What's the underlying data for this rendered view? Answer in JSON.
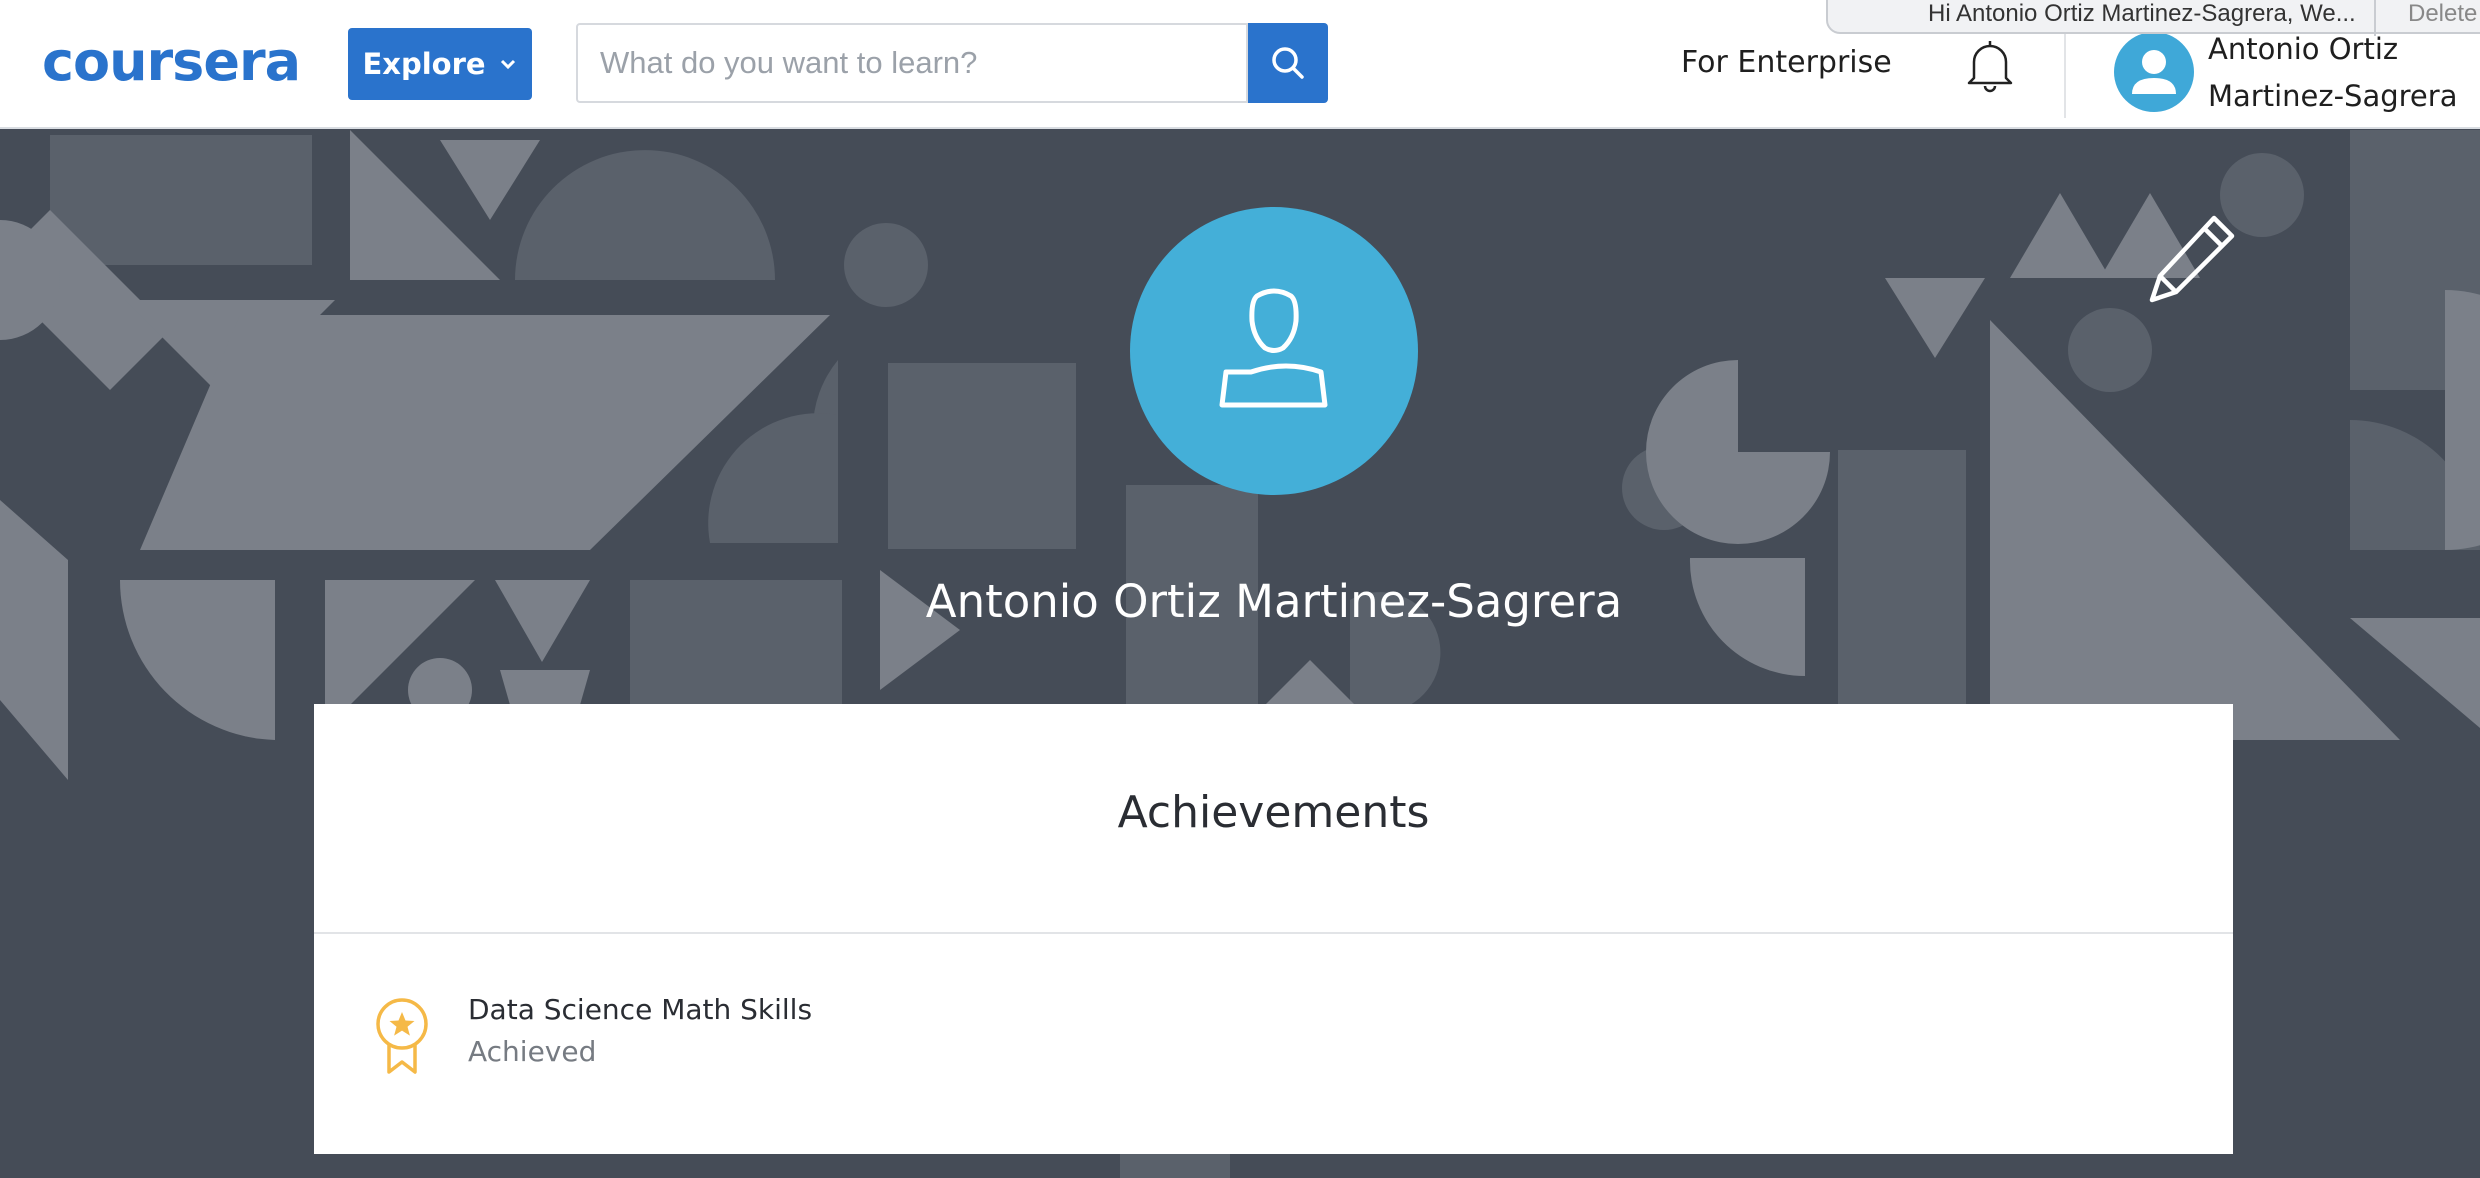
{
  "header": {
    "logo": "coursera",
    "explore_label": "Explore",
    "search_placeholder": "What do you want to learn?",
    "enterprise_label": "For Enterprise",
    "user_name_line1": "Antonio Ortiz",
    "user_name_line2": "Martinez-Sagrera"
  },
  "notification": {
    "text": "Hi Antonio Ortiz Martinez-Sagrera, We...",
    "delete_label": "Delete"
  },
  "profile": {
    "name": "Antonio Ortiz Martinez-Sagrera"
  },
  "achievements": {
    "title": "Achievements",
    "items": [
      {
        "name": "Data Science Math Skills",
        "status": "Achieved"
      }
    ]
  },
  "colors": {
    "brand_blue": "#2a73cc",
    "avatar_blue": "#44afd8",
    "background_dark": "#454c57",
    "badge_gold": "#f5b947"
  },
  "icons": [
    "search-icon",
    "chevron-down-icon",
    "bell-icon",
    "user-avatar-icon",
    "pencil-icon",
    "award-ribbon-icon"
  ]
}
